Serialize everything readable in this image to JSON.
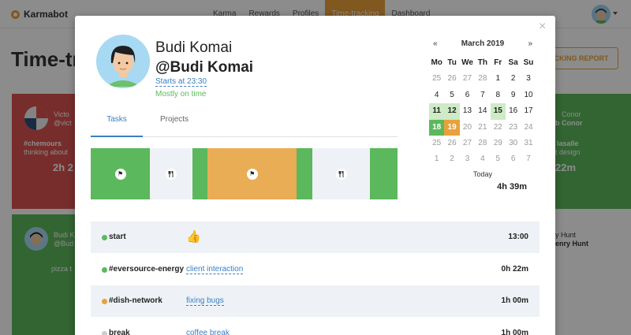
{
  "app": {
    "name": "Karmabot"
  },
  "nav": [
    "Karma",
    "Rewards",
    "Profiles",
    "Time-tracking",
    "Dashboard"
  ],
  "nav_active": "Time-tracking",
  "page": {
    "title": "Time-tra",
    "report_button": "CKING REPORT"
  },
  "background_cards": {
    "left_top": {
      "name": "Victo",
      "handle": "@vict",
      "project": "#chemours",
      "note": "thinking about",
      "time": "2h 2"
    },
    "left_bottom": {
      "name": "Budi K",
      "handle": "@Bud",
      "note": "pizza t"
    },
    "right_top": {
      "name": "Conor",
      "handle": "b Conor",
      "project": "lasalle",
      "note": "t design",
      "time": "22m"
    },
    "right_bottom": {
      "name": "y Hunt",
      "handle": "enry Hunt"
    }
  },
  "profile": {
    "name": "Budi Komai",
    "handle": "@Budi Komai",
    "starts": "Starts at 23:30",
    "status": "Mostly on time"
  },
  "tabs": [
    {
      "label": "Tasks",
      "active": true
    },
    {
      "label": "Projects",
      "active": false
    }
  ],
  "timeline": [
    {
      "kind": "work",
      "color": "#5cb85c",
      "share": 0.193,
      "icon": "flag-icon"
    },
    {
      "kind": "break",
      "color": "#eef2f6",
      "share": 0.139,
      "icon": "fork-knife-icon"
    },
    {
      "kind": "work",
      "color": "#5cb85c",
      "share": 0.049,
      "icon": null
    },
    {
      "kind": "work",
      "color": "#e9ad55",
      "share": 0.291,
      "icon": "flag-icon"
    },
    {
      "kind": "work",
      "color": "#5cb85c",
      "share": 0.051,
      "icon": null
    },
    {
      "kind": "break",
      "color": "#eef2f6",
      "share": 0.188,
      "icon": "fork-knife-icon"
    },
    {
      "kind": "work",
      "color": "#5cb85c",
      "share": 0.089,
      "icon": null
    }
  ],
  "calendar": {
    "prev": "«",
    "next": "»",
    "month": "March 2019",
    "weekdays": [
      "Mo",
      "Tu",
      "We",
      "Th",
      "Fr",
      "Sa",
      "Su"
    ],
    "weeks": [
      [
        {
          "d": "25",
          "s": "muted"
        },
        {
          "d": "26",
          "s": "muted"
        },
        {
          "d": "27",
          "s": "muted"
        },
        {
          "d": "28",
          "s": "muted"
        },
        {
          "d": "1",
          "s": ""
        },
        {
          "d": "2",
          "s": ""
        },
        {
          "d": "3",
          "s": ""
        }
      ],
      [
        {
          "d": "4",
          "s": ""
        },
        {
          "d": "5",
          "s": ""
        },
        {
          "d": "6",
          "s": ""
        },
        {
          "d": "7",
          "s": ""
        },
        {
          "d": "8",
          "s": ""
        },
        {
          "d": "9",
          "s": ""
        },
        {
          "d": "10",
          "s": ""
        }
      ],
      [
        {
          "d": "11",
          "s": "light-green"
        },
        {
          "d": "12",
          "s": "light-green"
        },
        {
          "d": "13",
          "s": ""
        },
        {
          "d": "14",
          "s": ""
        },
        {
          "d": "15",
          "s": "light-green"
        },
        {
          "d": "16",
          "s": ""
        },
        {
          "d": "17",
          "s": ""
        }
      ],
      [
        {
          "d": "18",
          "s": "green"
        },
        {
          "d": "19",
          "s": "orange"
        },
        {
          "d": "20",
          "s": "muted"
        },
        {
          "d": "21",
          "s": "muted"
        },
        {
          "d": "22",
          "s": "muted"
        },
        {
          "d": "23",
          "s": "muted"
        },
        {
          "d": "24",
          "s": "muted"
        }
      ],
      [
        {
          "d": "25",
          "s": "muted"
        },
        {
          "d": "26",
          "s": "muted"
        },
        {
          "d": "27",
          "s": "muted"
        },
        {
          "d": "28",
          "s": "muted"
        },
        {
          "d": "29",
          "s": "muted"
        },
        {
          "d": "30",
          "s": "muted"
        },
        {
          "d": "31",
          "s": "muted"
        }
      ],
      [
        {
          "d": "1",
          "s": "muted"
        },
        {
          "d": "2",
          "s": "muted"
        },
        {
          "d": "3",
          "s": "muted"
        },
        {
          "d": "4",
          "s": "muted"
        },
        {
          "d": "5",
          "s": "muted"
        },
        {
          "d": "6",
          "s": "muted"
        },
        {
          "d": "7",
          "s": "muted"
        }
      ]
    ],
    "today_label": "Today",
    "today_value": "4h 39m"
  },
  "entries": [
    {
      "dot": "#5cb85c",
      "project": "start",
      "task": "",
      "thumb": true,
      "duration": "13:00",
      "shaded": true
    },
    {
      "dot": "#5cb85c",
      "project": "#eversource-energy",
      "task": "client interaction",
      "thumb": false,
      "duration": "0h 22m",
      "shaded": false
    },
    {
      "dot": "#e9a13b",
      "project": "#dish-network",
      "task": "fixing bugs",
      "thumb": false,
      "duration": "1h 00m",
      "shaded": true
    },
    {
      "dot": "#cccccc",
      "project": "break",
      "task": "coffee break",
      "thumb": false,
      "duration": "1h 00m",
      "shaded": false
    }
  ],
  "colors": {
    "accent": "#e9a13b",
    "green": "#5cb85c",
    "link": "#3a7fc2",
    "danger": "#d9534f"
  }
}
